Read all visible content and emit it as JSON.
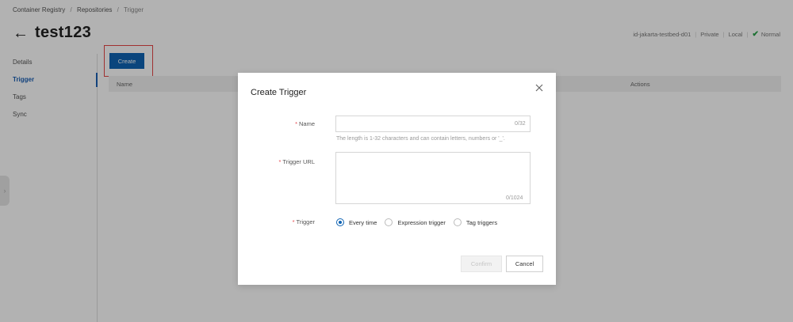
{
  "breadcrumb": [
    "Container Registry",
    "Repositories",
    "Trigger"
  ],
  "header": {
    "title": "test123",
    "back_icon": "arrow-left-icon"
  },
  "status": {
    "region": "id-jakarta-testbed-d01",
    "visibility": "Private",
    "source": "Local",
    "state": "Normal",
    "state_color": "#2aa34a"
  },
  "sidebar": {
    "items": [
      {
        "label": "Details",
        "active": false
      },
      {
        "label": "Trigger",
        "active": true
      },
      {
        "label": "Tags",
        "active": false
      },
      {
        "label": "Sync",
        "active": false
      }
    ]
  },
  "toolbar": {
    "create_label": "Create"
  },
  "table": {
    "columns": [
      "Name",
      "Actions"
    ]
  },
  "dialog": {
    "title": "Create Trigger",
    "name_label": "Name",
    "name_value": "",
    "name_counter": "0/32",
    "name_hint": "The length is 1-32 characters and can contain letters, numbers or '_'.",
    "url_label": "Trigger URL",
    "url_value": "",
    "url_counter": "0/1024",
    "trigger_label": "Trigger",
    "trigger_options": [
      {
        "label": "Every time",
        "checked": true
      },
      {
        "label": "Expression trigger",
        "checked": false
      },
      {
        "label": "Tag triggers",
        "checked": false
      }
    ],
    "confirm_label": "Confirm",
    "cancel_label": "Cancel"
  },
  "colors": {
    "primary": "#0f63b3",
    "required": "#e5484d"
  }
}
